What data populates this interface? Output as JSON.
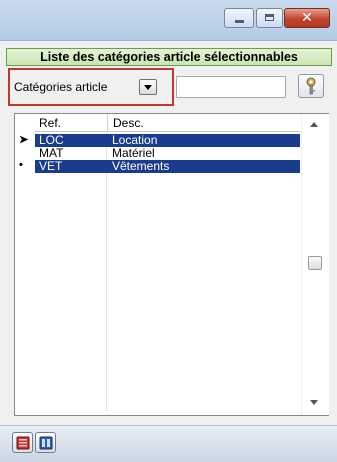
{
  "window": {
    "controls": [
      "minimize-icon",
      "maximize-icon",
      "close-icon"
    ],
    "close_glyph": "✕"
  },
  "panel": {
    "title": "Liste des catégories article sélectionnables"
  },
  "filter": {
    "category_label": "Catégories article",
    "search_value": ""
  },
  "list": {
    "columns": [
      "Ref.",
      "Desc."
    ],
    "rows": [
      {
        "indicator": "➤",
        "ref": "LOC",
        "desc": "Location",
        "selected": true
      },
      {
        "indicator": "",
        "ref": "MAT",
        "desc": "Matériel",
        "selected": false
      },
      {
        "indicator": "•",
        "ref": "VET",
        "desc": "Vêtements",
        "selected": true
      }
    ]
  },
  "toolbar": {
    "buttons": [
      "red-list-icon",
      "blue-list-icon"
    ]
  },
  "colors": {
    "selection": "#1a3c8f",
    "highlight_border": "#c0392b",
    "panel_title_bg": "#d4ecc0"
  }
}
